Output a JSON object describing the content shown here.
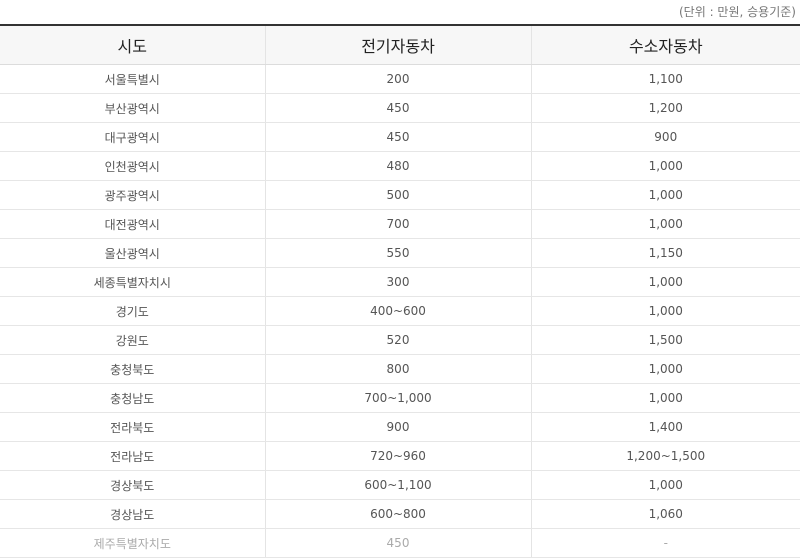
{
  "unit_note": "(단위 : 만원, 승용기준)",
  "headers": [
    "시도",
    "전기자동차",
    "수소자동차"
  ],
  "rows": [
    [
      "서울특별시",
      "200",
      "1,100"
    ],
    [
      "부산광역시",
      "450",
      "1,200"
    ],
    [
      "대구광역시",
      "450",
      "900"
    ],
    [
      "인천광역시",
      "480",
      "1,000"
    ],
    [
      "광주광역시",
      "500",
      "1,000"
    ],
    [
      "대전광역시",
      "700",
      "1,000"
    ],
    [
      "울산광역시",
      "550",
      "1,150"
    ],
    [
      "세종특별자치시",
      "300",
      "1,000"
    ],
    [
      "경기도",
      "400~600",
      "1,000"
    ],
    [
      "강원도",
      "520",
      "1,500"
    ],
    [
      "충청북도",
      "800",
      "1,000"
    ],
    [
      "충청남도",
      "700~1,000",
      "1,000"
    ],
    [
      "전라북도",
      "900",
      "1,400"
    ],
    [
      "전라남도",
      "720~960",
      "1,200~1,500"
    ],
    [
      "경상북도",
      "600~1,100",
      "1,000"
    ],
    [
      "경상남도",
      "600~800",
      "1,060"
    ],
    [
      "제주특별자치도",
      "450",
      "-"
    ]
  ]
}
